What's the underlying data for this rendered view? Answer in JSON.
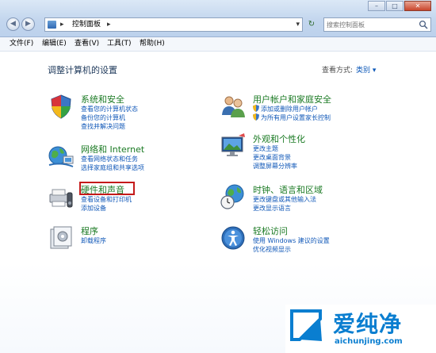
{
  "address": {
    "breadcrumb": "控制面板"
  },
  "search": {
    "placeholder": "搜索控制面板"
  },
  "menu": [
    "文件(F)",
    "编辑(E)",
    "查看(V)",
    "工具(T)",
    "帮助(H)"
  ],
  "page_title": "调整计算机的设置",
  "view_by": {
    "label": "查看方式:",
    "value": "类别 ▾"
  },
  "categories": [
    {
      "title": "系统和安全",
      "icon": "system-security-icon",
      "links": [
        "查看您的计算机状态",
        "备份您的计算机",
        "查找并解决问题"
      ]
    },
    {
      "title": "网络和 Internet",
      "icon": "network-internet-icon",
      "links": [
        "查看网络状态和任务",
        "选择家庭组和共享选项"
      ]
    },
    {
      "title": "硬件和声音",
      "icon": "hardware-sound-icon",
      "links": [
        "查看设备和打印机",
        "添加设备"
      ],
      "highlighted": true
    },
    {
      "title": "程序",
      "icon": "programs-icon",
      "links": [
        "卸载程序"
      ]
    },
    {
      "title": "用户帐户和家庭安全",
      "icon": "user-accounts-icon",
      "links": [
        "添加或删除用户帐户",
        "为所有用户设置家长控制"
      ]
    },
    {
      "title": "外观和个性化",
      "icon": "appearance-icon",
      "links": [
        "更改主题",
        "更改桌面背景",
        "调整屏幕分辨率"
      ]
    },
    {
      "title": "时钟、语言和区域",
      "icon": "clock-language-region-icon",
      "links": [
        "更改键盘或其他输入法",
        "更改显示语言"
      ]
    },
    {
      "title": "轻松访问",
      "icon": "ease-of-access-icon",
      "links": [
        "使用 Windows 建议的设置",
        "优化视频显示"
      ]
    }
  ],
  "watermark": {
    "text": "爱纯净",
    "url": "aichunjing.com"
  },
  "colors": {
    "category_title": "#1a7a23",
    "link": "#1158b8",
    "highlight_box": "#c41a1a",
    "watermark": "#0a7ed0"
  }
}
